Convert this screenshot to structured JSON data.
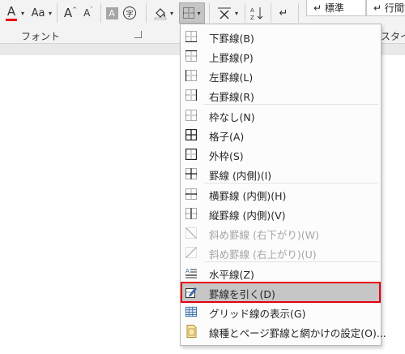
{
  "ribbon": {
    "font_group_label": "フォント",
    "font_color_letter": "A",
    "aa_label": "Aa",
    "grow_font_letter": "A",
    "shrink_font_letter": "A",
    "char_shading_letter": "A",
    "enclose_char": "字",
    "style_normal": "↵ 標準",
    "style_no_spacing": "↵ 行間詰",
    "side_label": "スタイル",
    "accent_red": "#e60012"
  },
  "menu": {
    "items": [
      {
        "label": "下罫線(B)",
        "icon": "bottom-border-icon"
      },
      {
        "label": "上罫線(P)",
        "icon": "top-border-icon"
      },
      {
        "label": "左罫線(L)",
        "icon": "left-border-icon"
      },
      {
        "label": "右罫線(R)",
        "icon": "right-border-icon"
      },
      {
        "label": "枠なし(N)",
        "icon": "no-border-icon"
      },
      {
        "label": "格子(A)",
        "icon": "all-borders-icon"
      },
      {
        "label": "外枠(S)",
        "icon": "outside-borders-icon"
      },
      {
        "label": "罫線 (内側)(I)",
        "icon": "inside-borders-icon"
      },
      {
        "label": "横罫線 (内側)(H)",
        "icon": "inside-horizontal-border-icon"
      },
      {
        "label": "縦罫線 (内側)(V)",
        "icon": "inside-vertical-border-icon"
      },
      {
        "label": "斜め罫線 (右下がり)(W)",
        "icon": "diagonal-down-border-icon",
        "disabled": true
      },
      {
        "label": "斜め罫線 (右上がり)(U)",
        "icon": "diagonal-up-border-icon",
        "disabled": true
      },
      {
        "label": "水平線(Z)",
        "icon": "horizontal-line-icon"
      },
      {
        "label": "罫線を引く(D)",
        "icon": "draw-table-icon",
        "highlighted": true
      },
      {
        "label": "グリッド線の表示(G)",
        "icon": "view-gridlines-icon"
      },
      {
        "label": "線種とページ罫線と網かけの設定(O)...",
        "icon": "borders-shading-icon"
      }
    ]
  }
}
